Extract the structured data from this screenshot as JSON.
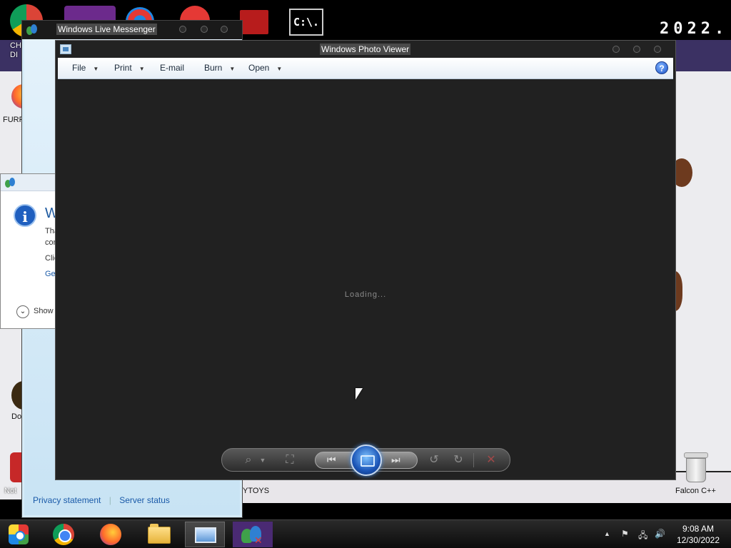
{
  "desktop": {
    "year_text": "2022.",
    "icons": [
      {
        "label": "CHI\nDI"
      },
      {
        "label": "FURR"
      },
      {
        "label": "Do"
      },
      {
        "label": "Not"
      },
      {
        "label": "Falcon C++"
      }
    ],
    "label_chi": "CHI",
    "label_di": "DI",
    "label_furr": "FURR",
    "label_do": "Do",
    "label_not": "Not",
    "label_falcon": "Falcon C++",
    "label_ytoys": "YTOYS",
    "cmd_icon_text": "C:\\."
  },
  "messenger": {
    "title": "Windows Live Messenger",
    "footer": {
      "privacy": "Privacy statement",
      "server": "Server status"
    }
  },
  "dialog": {
    "heading_fragment": "W",
    "line1": "Tha",
    "line2": "con",
    "line3": "Clic",
    "link": "Ge",
    "show_label": "Show"
  },
  "photo_viewer": {
    "title": "Windows Photo Viewer",
    "menu": {
      "file": "File",
      "print": "Print",
      "email": "E-mail",
      "burn": "Burn",
      "open": "Open"
    },
    "help": "?",
    "status": "Loading..."
  },
  "taskbar": {
    "time": "9:08 AM",
    "date": "12/30/2022"
  }
}
